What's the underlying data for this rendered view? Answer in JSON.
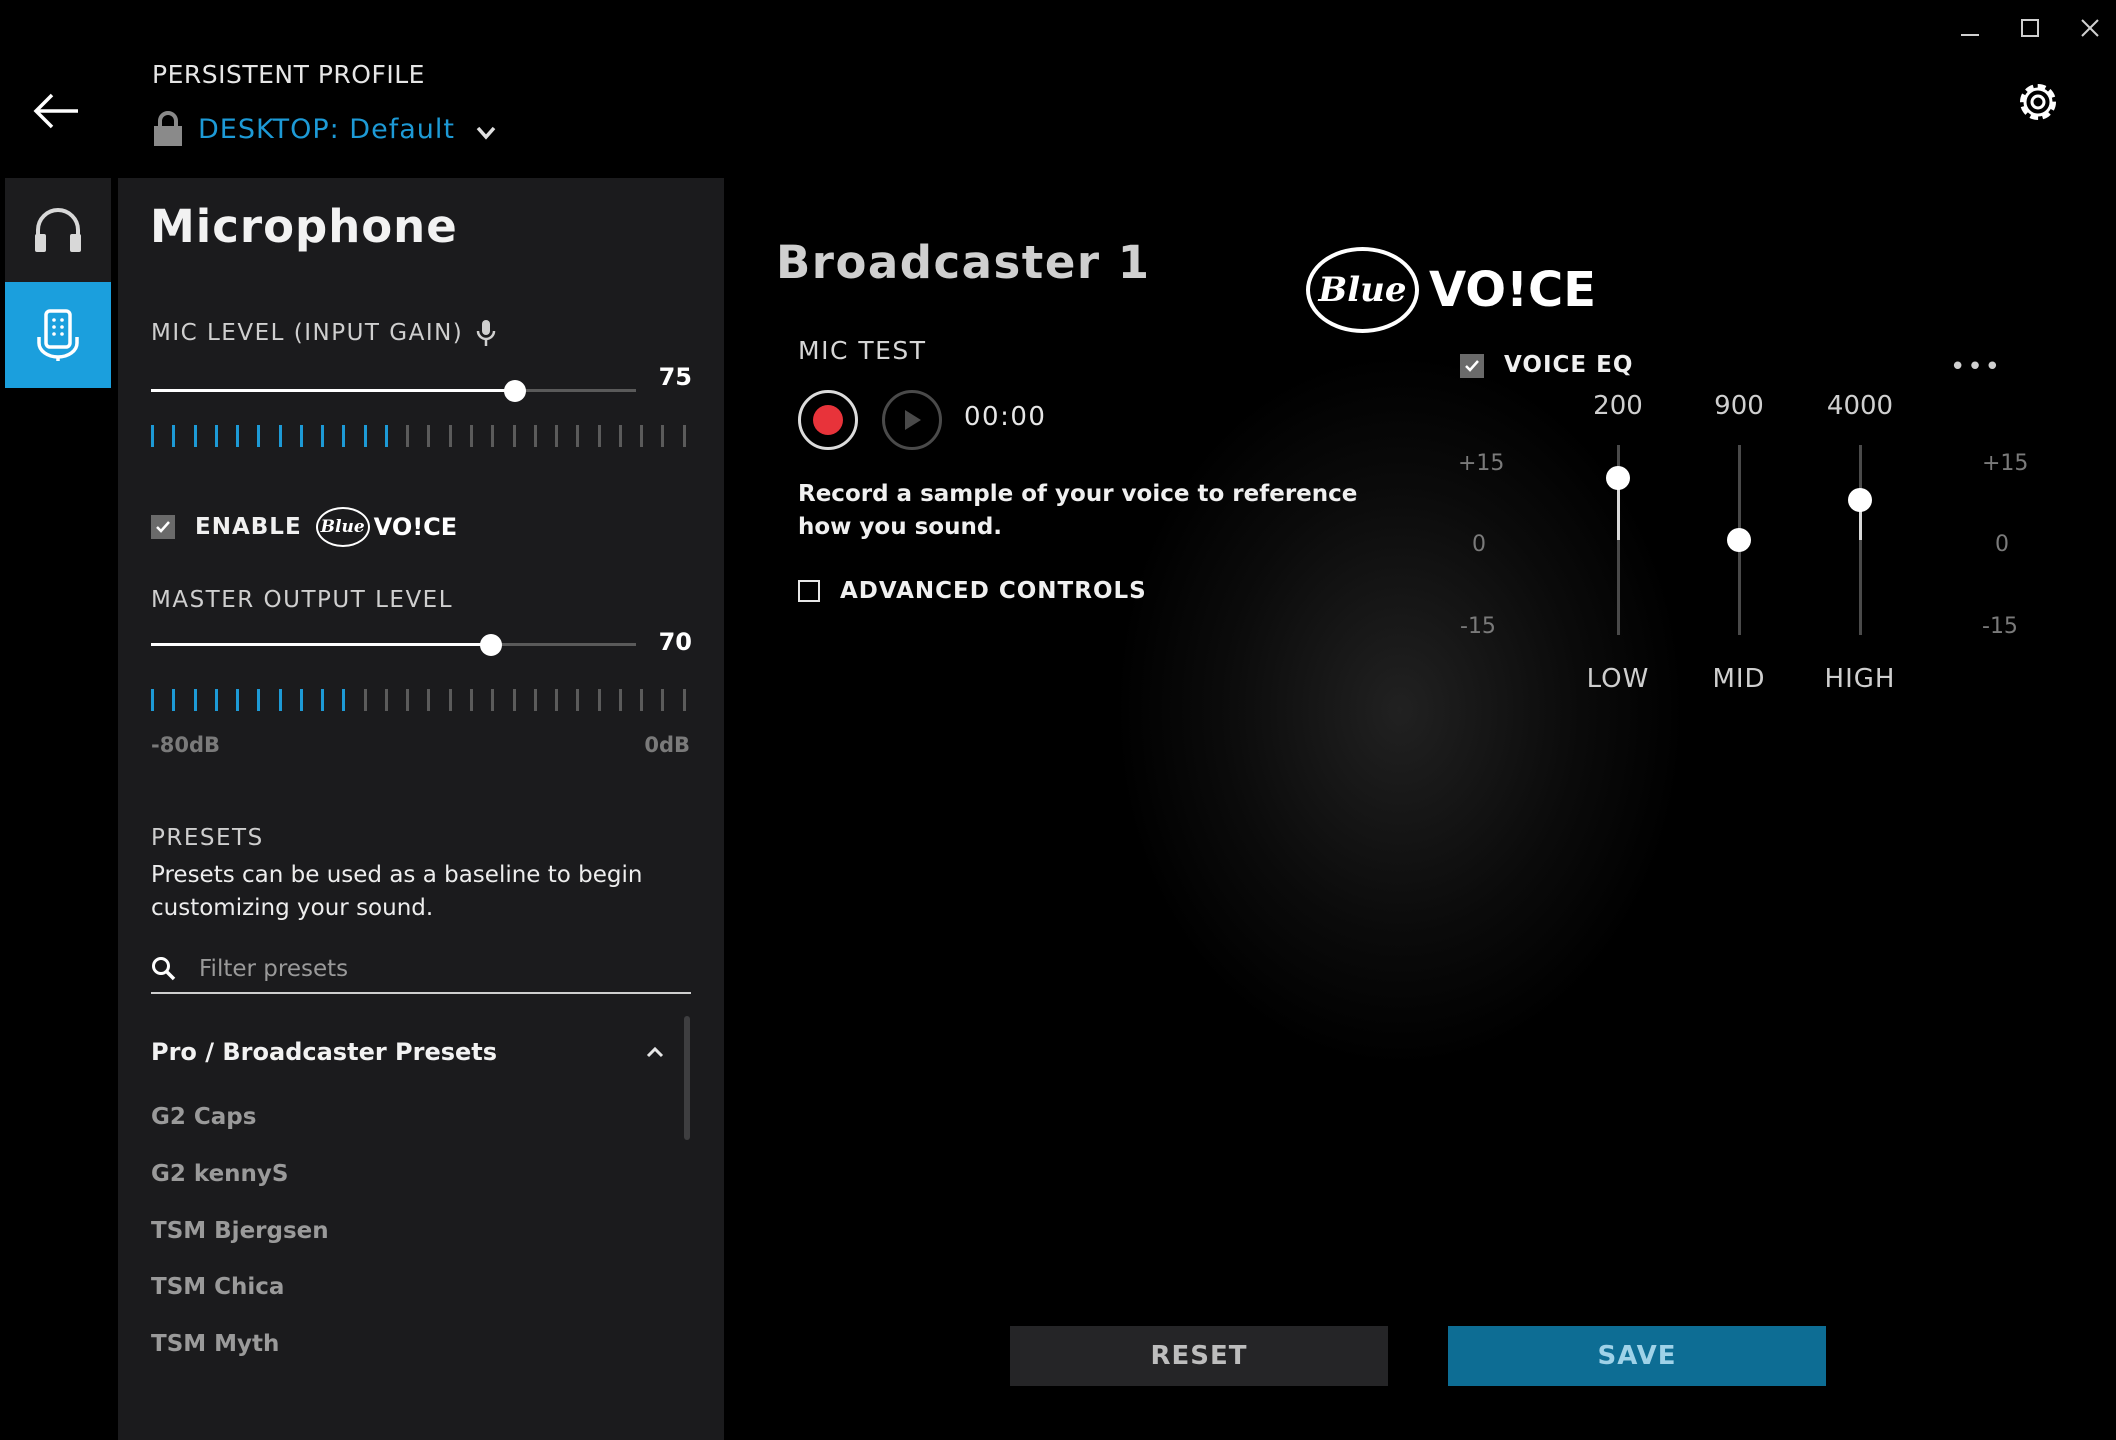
{
  "window": {
    "minimize_icon": "minimize-icon",
    "maximize_icon": "maximize-icon",
    "close_icon": "close-icon"
  },
  "header": {
    "back_icon": "arrow-left-icon",
    "profile_label": "PERSISTENT PROFILE",
    "profile_name": "DESKTOP: Default",
    "lock_icon": "lock-icon",
    "dropdown_icon": "chevron-down-icon",
    "settings_icon": "gear-icon"
  },
  "nav": {
    "items": [
      {
        "icon": "headset-icon",
        "active": false
      },
      {
        "icon": "microphone-device-icon",
        "active": true
      }
    ]
  },
  "microphone": {
    "title": "Microphone",
    "mic_level": {
      "label": "MIC LEVEL (INPUT GAIN)",
      "value": "75",
      "meter_active_segments": 12,
      "meter_total_segments": 26
    },
    "enable_blue_voice": {
      "label": "ENABLE",
      "logo_text": "Blue",
      "logo_voice": "VO!CE",
      "checked": true
    },
    "master_output": {
      "label": "MASTER OUTPUT LEVEL",
      "value": "70",
      "meter_active_segments": 10,
      "meter_total_segments": 26,
      "min_label": "-80dB",
      "max_label": "0dB"
    },
    "presets": {
      "heading": "PRESETS",
      "description": "Presets can be used as a baseline to begin customizing your sound.",
      "filter_placeholder": "Filter presets",
      "group_title": "Pro / Broadcaster Presets",
      "items": [
        "G2 Caps",
        "G2 kennyS",
        "TSM Bjergsen",
        "TSM Chica",
        "TSM Myth"
      ]
    }
  },
  "detail": {
    "title": "Broadcaster 1",
    "logo_text": "Blue",
    "logo_voice": "VO!CE",
    "mic_test": {
      "label": "MIC TEST",
      "timer": "00:00",
      "description": "Record a sample of your voice to reference how you sound."
    },
    "advanced_controls_label": "ADVANCED CONTROLS",
    "voice_eq": {
      "label": "VOICE EQ",
      "checked": true,
      "more": "•••",
      "scale_top": "+15",
      "scale_mid": "0",
      "scale_bottom": "-15",
      "bands": [
        {
          "freq": "200",
          "name": "LOW",
          "level": 11
        },
        {
          "freq": "900",
          "name": "MID",
          "level": 0
        },
        {
          "freq": "4000",
          "name": "HIGH",
          "level": 7
        }
      ]
    },
    "reset_label": "RESET",
    "save_label": "SAVE"
  }
}
